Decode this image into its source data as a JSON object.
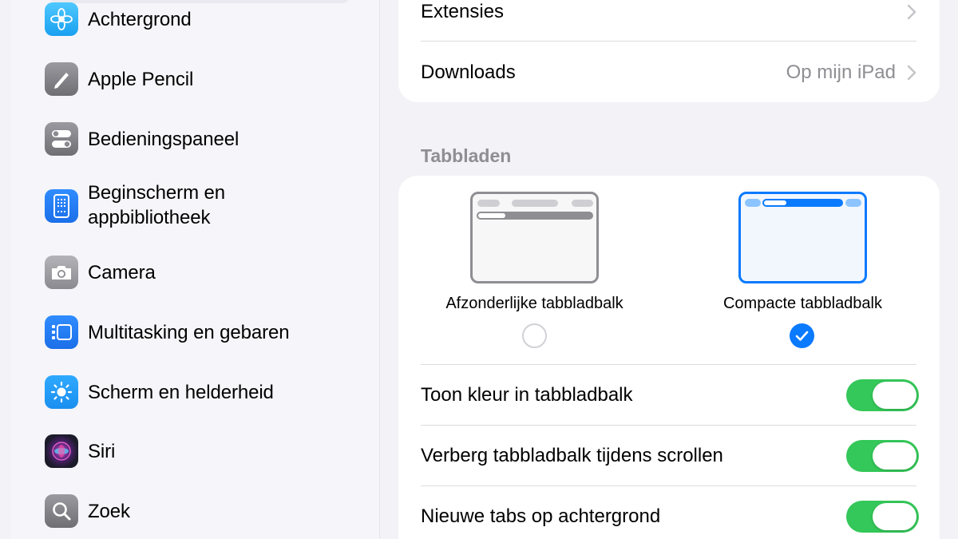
{
  "sidebar": {
    "items": [
      {
        "label": "Achtergrond",
        "icon": "flower-icon"
      },
      {
        "label": "Apple Pencil",
        "icon": "pencil-icon"
      },
      {
        "label": "Bedieningspaneel",
        "icon": "toggles-icon"
      },
      {
        "label": "Beginscherm en",
        "label2": "appbibliotheek",
        "icon": "home-screen-icon"
      },
      {
        "label": "Camera",
        "icon": "camera-icon"
      },
      {
        "label": "Multitasking en gebaren",
        "icon": "multitasking-icon"
      },
      {
        "label": "Scherm en helderheid",
        "icon": "sun-icon"
      },
      {
        "label": "Siri",
        "icon": "siri-icon"
      },
      {
        "label": "Zoek",
        "icon": "search-icon"
      }
    ]
  },
  "general": {
    "extensions": {
      "label": "Extensies"
    },
    "downloads": {
      "label": "Downloads",
      "value": "Op mijn iPad"
    }
  },
  "tabs": {
    "section_title": "Tabbladen",
    "separate": {
      "label": "Afzonderlijke tabbladbalk",
      "selected": false
    },
    "compact": {
      "label": "Compacte tabbladbalk",
      "selected": true
    },
    "toggles": [
      {
        "label": "Toon kleur in tabbladbalk",
        "on": true
      },
      {
        "label": "Verberg tabbladbalk tijdens scrollen",
        "on": true
      },
      {
        "label": "Nieuwe tabs op achtergrond",
        "on": true
      }
    ]
  },
  "colors": {
    "accent": "#0a7aff",
    "toggle_on": "#34c759"
  }
}
